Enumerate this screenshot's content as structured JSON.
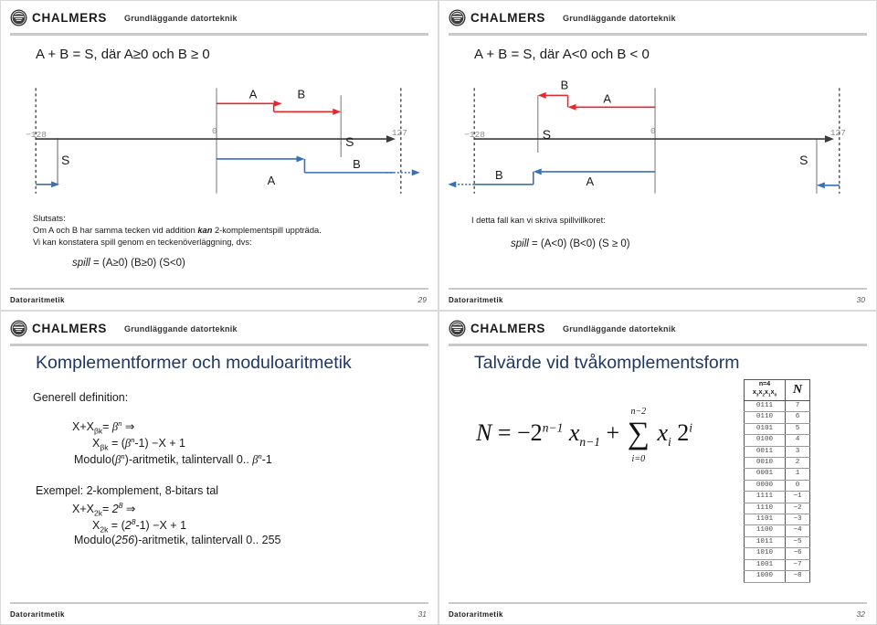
{
  "brand": {
    "name": "CHALMERS",
    "course": "Grundläggande datorteknik",
    "seal_icon": "chalmers-seal-icon",
    "title_color": "#1F3864"
  },
  "slides": [
    {
      "id": "slide-29",
      "headline": "A + B = S, där A≥0 och B ≥ 0",
      "diagram": {
        "label_min": "−128",
        "label_zero": "0",
        "label_max": "127",
        "label_s_upper": "S",
        "label_s_lower": "S",
        "label_a_upper": "A",
        "label_b_upper": "B",
        "label_a_lower": "A",
        "label_b_lower": "B",
        "color_upper": "#e8272c",
        "color_lower": "#3b6fb6",
        "color_axis": "#3a3a3a"
      },
      "body": {
        "line1": "Slutsats:",
        "line2_a": "Om A och B har samma tecken vid addition ",
        "line2_b": "kan",
        "line2_c": " 2-komplementspill uppträda.",
        "line3": "Vi kan konstatera spill genom en teckenöverläggning, dvs:",
        "formula_name": "spill",
        "formula_rest": " = (A≥0) (B≥0) (S<0)"
      },
      "footer": {
        "left": "Datoraritmetik",
        "right": "29"
      }
    },
    {
      "id": "slide-30",
      "headline": "A + B = S, där A<0 och B < 0",
      "diagram": {
        "label_min": "−128",
        "label_zero": "0",
        "label_max": "127",
        "label_s_upper": "S",
        "label_s_lower": "S",
        "label_a_upper": "A",
        "label_b_upper": "B",
        "label_a_lower": "A",
        "label_b_lower": "B",
        "color_upper": "#e8272c",
        "color_lower": "#3b6fb6",
        "color_axis": "#3a3a3a"
      },
      "body": {
        "line1": "I detta fall kan vi skriva spillvillkoret:",
        "formula_name": "spill",
        "formula_rest": " = (A<0) (B<0) (S ≥ 0)"
      },
      "footer": {
        "left": "Datoraritmetik",
        "right": "30"
      }
    },
    {
      "id": "slide-31",
      "title": "Komplementformer och moduloaritmetik",
      "subtitle": "Generell definition:",
      "general": {
        "l1_pre": "X+X",
        "l1_sub": "βk",
        "l1_eq": "= ",
        "l1_beta": "β",
        "l1_exp": "n",
        "l1_arrow": " ⇒",
        "l2_pre": "X",
        "l2_sub": "βk",
        "l2_mid": " = (",
        "l2_beta": "β",
        "l2_exp": "n",
        "l2_post": "-1) −X + 1",
        "l3_pre": "Modulo(",
        "l3_beta": "β",
        "l3_exp": "n",
        "l3_post": ")-aritmetik, talintervall 0.. ",
        "l3_beta2": "β",
        "l3_exp2": "n",
        "l3_tail": "-1"
      },
      "example": {
        "heading": "Exempel: 2-komplement, 8-bitars tal",
        "l1_pre": "X+X",
        "l1_sub": "2k",
        "l1_eq": "= ",
        "l1_base": "2",
        "l1_exp": "8",
        "l1_arrow": " ⇒",
        "l2_pre": "X",
        "l2_sub": "2k",
        "l2_mid": " = (",
        "l2_base": "2",
        "l2_exp": "8",
        "l2_post": "-1) −X + 1",
        "l3_pre": "Modulo(",
        "l3_val": "256",
        "l3_post": ")-aritmetik, talintervall 0.. 255"
      },
      "footer": {
        "left": "Datoraritmetik",
        "right": "31"
      }
    },
    {
      "id": "slide-32",
      "title": "Talvärde vid tvåkomplementsform",
      "equation": {
        "n": "N",
        "eq": "=",
        "minus_two": "−2",
        "exp1": "n−1",
        "x1": "x",
        "x1sub": "n−1",
        "plus": "+",
        "sigma_top": "n−2",
        "sigma": "∑",
        "sigma_bot": "i=0",
        "x2": "x",
        "x2sub": "i",
        "two": "2",
        "exp2": "i"
      },
      "table": {
        "header_bits_line1": "n=4",
        "header_bits_line2_parts": [
          "x",
          "3",
          "x",
          "2",
          "x",
          "1",
          "x",
          "0"
        ],
        "header_value": "N",
        "rows": [
          {
            "bits": "0111",
            "value": "7"
          },
          {
            "bits": "0110",
            "value": "6"
          },
          {
            "bits": "0101",
            "value": "5"
          },
          {
            "bits": "0100",
            "value": "4"
          },
          {
            "bits": "0011",
            "value": "3"
          },
          {
            "bits": "0010",
            "value": "2"
          },
          {
            "bits": "0001",
            "value": "1"
          },
          {
            "bits": "0000",
            "value": "0"
          },
          {
            "bits": "1111",
            "value": "−1"
          },
          {
            "bits": "1110",
            "value": "−2"
          },
          {
            "bits": "1101",
            "value": "−3"
          },
          {
            "bits": "1100",
            "value": "−4"
          },
          {
            "bits": "1011",
            "value": "−5"
          },
          {
            "bits": "1010",
            "value": "−6"
          },
          {
            "bits": "1001",
            "value": "−7"
          },
          {
            "bits": "1000",
            "value": "−8"
          }
        ]
      },
      "footer": {
        "left": "Datoraritmetik",
        "right": "32"
      }
    }
  ]
}
